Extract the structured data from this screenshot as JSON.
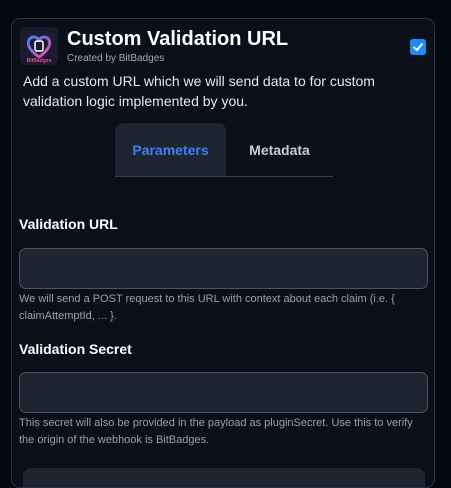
{
  "plugin": {
    "title": "Custom Validation URL",
    "created_by": "Created by BitBadges",
    "logo_text": "BitBadges",
    "enabled": true,
    "description": "Add a custom URL which we will send data to for custom validation logic implemented by you."
  },
  "tabs": [
    {
      "label": "Parameters",
      "active": true
    },
    {
      "label": "Metadata",
      "active": false
    }
  ],
  "fields": {
    "validation_url": {
      "label": "Validation URL",
      "value": "",
      "placeholder": "",
      "help": "We will send a POST request to this URL with context about each claim (i.e. { claimAttemptId, ... }."
    },
    "validation_secret": {
      "label": "Validation Secret",
      "value": "",
      "placeholder": "",
      "help": "This secret will also be provided in the payload as pluginSecret. Use this to verify the origin of the webhook is BitBadges."
    }
  },
  "colors": {
    "accent": "#3b82f6",
    "checkbox": "#1d8cf8",
    "logo_gradient_start": "#3b82f6",
    "logo_gradient_end": "#ec4899"
  }
}
